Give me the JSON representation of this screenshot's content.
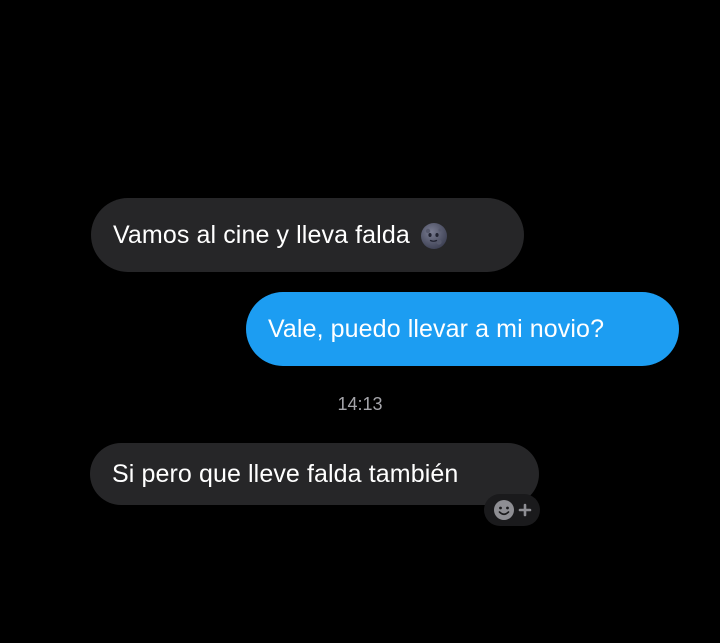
{
  "messages": [
    {
      "direction": "incoming",
      "text": "Vamos al cine y lleva falda",
      "emoji": "new-moon-face-emoji"
    },
    {
      "direction": "outgoing",
      "text": "Vale, puedo llevar a mi novio?"
    },
    {
      "direction": "incoming",
      "text": "Si pero que lleve falda también"
    }
  ],
  "timestamp": "14:13",
  "reaction_button": {
    "icon": "add-reaction-icon"
  },
  "colors": {
    "background": "#000000",
    "incoming_bubble": "#262628",
    "outgoing_bubble": "#1c9df2",
    "text": "#ffffff",
    "timestamp": "#a4a4a9"
  }
}
